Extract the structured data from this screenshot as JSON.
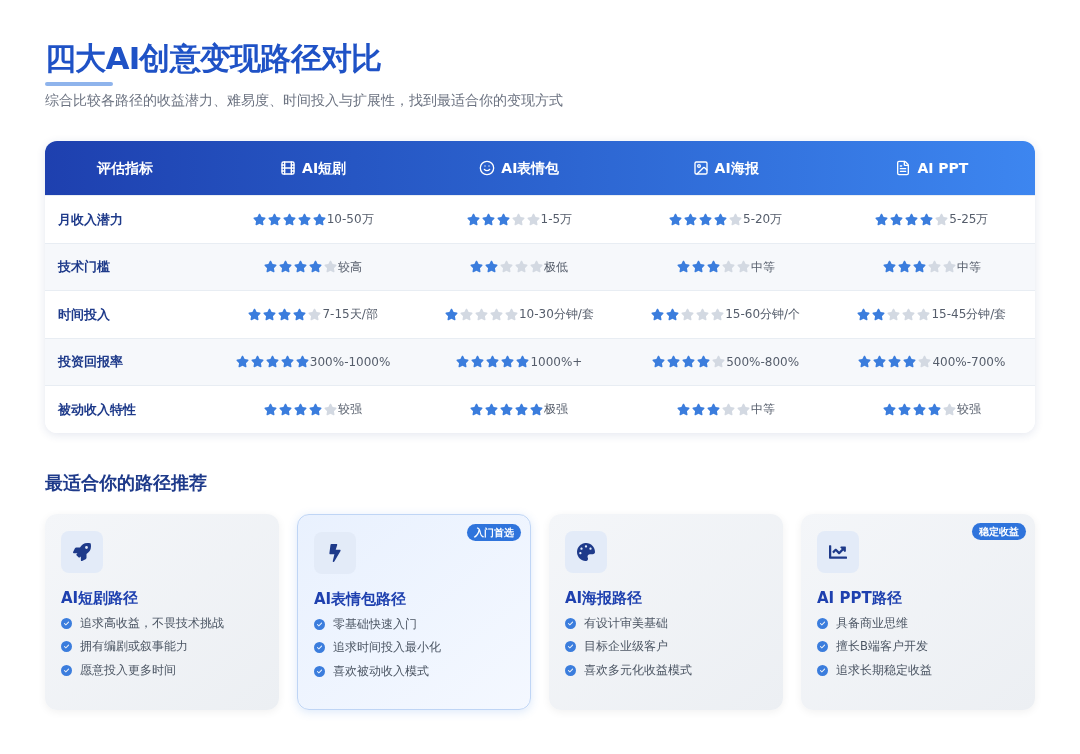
{
  "title": "四大AI创意变现路径对比",
  "subtitle": "综合比较各路径的收益潜力、难易度、时间投入与扩展性，找到最适合你的变现方式",
  "table": {
    "columns": [
      "评估指标",
      "AI短剧",
      "AI表情包",
      "AI海报",
      "AI PPT"
    ],
    "rows": [
      {
        "cells": [
          {
            "text": "月收入潜力"
          },
          {
            "stars": 5,
            "text": "10-50万"
          },
          {
            "stars": 3,
            "text": "1-5万"
          },
          {
            "stars": 4,
            "text": "5-20万"
          },
          {
            "stars": 4,
            "text": "5-25万"
          }
        ]
      },
      {
        "cells": [
          {
            "text": "技术门槛"
          },
          {
            "stars": 4,
            "text": "较高"
          },
          {
            "stars": 2,
            "text": "极低"
          },
          {
            "stars": 3,
            "text": "中等"
          },
          {
            "stars": 3,
            "text": "中等"
          }
        ]
      },
      {
        "cells": [
          {
            "text": "时间投入"
          },
          {
            "stars": 4,
            "text": "7-15天/部"
          },
          {
            "stars": 1,
            "text": "10-30分钟/套"
          },
          {
            "stars": 2,
            "text": "15-60分钟/个"
          },
          {
            "stars": 2,
            "text": "15-45分钟/套"
          }
        ]
      },
      {
        "cells": [
          {
            "text": "投资回报率"
          },
          {
            "stars": 5,
            "text": "300%-1000%"
          },
          {
            "stars": 5,
            "text": "1000%+"
          },
          {
            "stars": 4,
            "text": "500%-800%"
          },
          {
            "stars": 4,
            "text": "400%-700%"
          }
        ]
      },
      {
        "cells": [
          {
            "text": "被动收入特性"
          },
          {
            "stars": 4,
            "text": "较强"
          },
          {
            "stars": 5,
            "text": "极强"
          },
          {
            "stars": 3,
            "text": "中等"
          },
          {
            "stars": 4,
            "text": "较强"
          }
        ]
      }
    ]
  },
  "recommend": {
    "heading": "最适合你的路径推荐",
    "cards": [
      {
        "title": "AI短剧路径",
        "featured": false,
        "points": [
          "追求高收益，不畏技术挑战",
          "拥有编剧或叙事能力",
          "愿意投入更多时间"
        ]
      },
      {
        "title": "AI表情包路径",
        "featured": true,
        "badge": "入门首选",
        "points": [
          "零基础快速入门",
          "追求时间投入最小化",
          "喜欢被动收入模式"
        ]
      },
      {
        "title": "AI海报路径",
        "featured": false,
        "points": [
          "有设计审美基础",
          "目标企业级客户",
          "喜欢多元化收益模式"
        ]
      },
      {
        "title": "AI PPT路径",
        "featured": false,
        "badge": "稳定收益",
        "points": [
          "具备商业思维",
          "擅长B端客户开发",
          "追求长期稳定收益"
        ]
      }
    ]
  }
}
